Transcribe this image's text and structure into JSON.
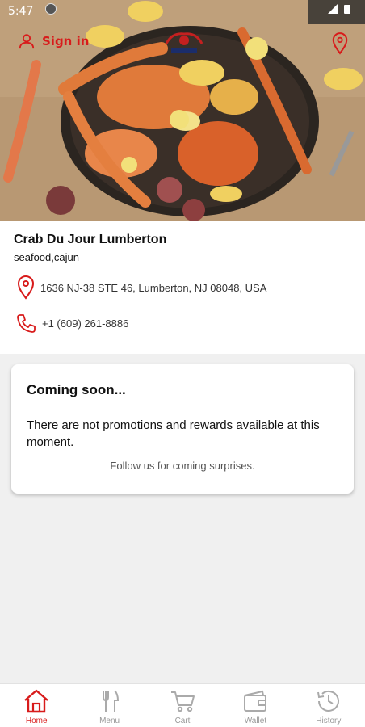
{
  "status_bar": {
    "time": "5:47"
  },
  "header": {
    "sign_in_label": "Sign in"
  },
  "restaurant": {
    "name": "Crab Du Jour Lumberton",
    "cuisine": "seafood,cajun",
    "address": "1636 NJ-38 STE 46,  Lumberton, NJ 08048, USA",
    "phone": "+1 (609) 261-8886"
  },
  "promo": {
    "title": "Coming soon...",
    "message": "There are not promotions and rewards available at this moment.",
    "follow": "Follow us for coming surprises."
  },
  "colors": {
    "accent": "#d81b1b",
    "inactive": "#999999"
  },
  "nav": {
    "items": [
      {
        "label": "Home",
        "icon": "home-icon"
      },
      {
        "label": "Menu",
        "icon": "fork-knife-icon"
      },
      {
        "label": "Cart",
        "icon": "cart-icon"
      },
      {
        "label": "Wallet",
        "icon": "wallet-icon"
      },
      {
        "label": "History",
        "icon": "history-icon"
      }
    ],
    "active": "Home"
  }
}
